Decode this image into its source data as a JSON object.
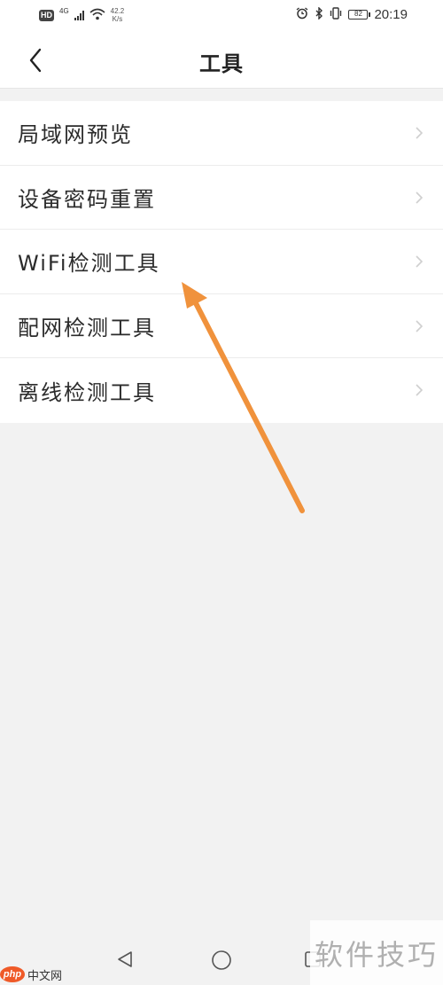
{
  "status_bar": {
    "hd_badge": "HD",
    "network_type": "4G",
    "speed_value": "42.2",
    "speed_unit": "K/s",
    "battery_level": "82",
    "time": "20:19",
    "icons": [
      "hd-icon",
      "signal-icon",
      "wifi-icon",
      "alarm-icon",
      "bluetooth-icon",
      "vibrate-icon",
      "battery-icon"
    ]
  },
  "header": {
    "title": "工具",
    "back_icon": "chevron-left-icon"
  },
  "tools": {
    "items": [
      {
        "label": "局域网预览"
      },
      {
        "label": "设备密码重置"
      },
      {
        "label": "WiFi检测工具"
      },
      {
        "label": "配网检测工具"
      },
      {
        "label": "离线检测工具"
      }
    ],
    "chevron_icon": "chevron-right-icon"
  },
  "annotation": {
    "color": "#f0923c",
    "target": "WiFi检测工具"
  },
  "nav_bar": {
    "icons": [
      "nav-back-icon",
      "nav-home-icon",
      "nav-recent-icon"
    ]
  },
  "watermarks": {
    "left_logo": "php",
    "left_text": "中文网",
    "right_text": "软件技巧"
  },
  "colors": {
    "background": "#f2f2f2",
    "surface": "#ffffff",
    "text": "#222222",
    "chevron": "#cfcfcf",
    "accent": "#f0923c"
  }
}
